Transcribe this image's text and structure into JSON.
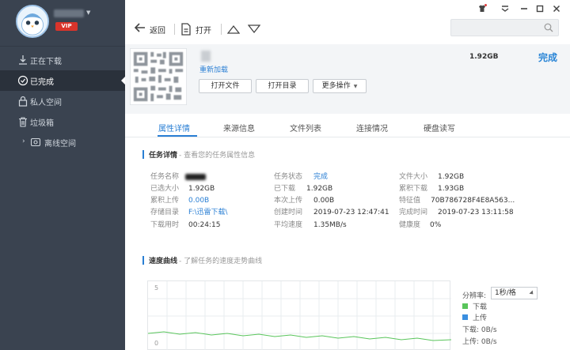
{
  "sidebar": {
    "vip_label": "VIP",
    "items": [
      {
        "label": "正在下载",
        "icon": "download-icon"
      },
      {
        "label": "已完成",
        "icon": "check-circle-icon"
      },
      {
        "label": "私人空间",
        "icon": "lock-icon"
      },
      {
        "label": "垃圾箱",
        "icon": "trash-icon"
      },
      {
        "label": "离线空间",
        "icon": "cloud-icon"
      }
    ]
  },
  "toolbar": {
    "back_label": "返回",
    "open_label": "打开"
  },
  "task": {
    "reload_label": "重新加载",
    "open_file_label": "打开文件",
    "open_dir_label": "打开目录",
    "more_label": "更多操作",
    "size": "1.92GB",
    "status": "完成"
  },
  "tabs": [
    "属性详情",
    "来源信息",
    "文件列表",
    "连接情况",
    "硬盘读写"
  ],
  "details": {
    "title": "任务详情",
    "subtitle": "- 查看您的任务属性信息",
    "rows": [
      {
        "l1": "任务名称",
        "v1": "",
        "l2": "任务状态",
        "v2": "完成",
        "l3": "文件大小",
        "v3": "1.92GB"
      },
      {
        "l1": "已选大小",
        "v1": "1.92GB",
        "l2": "已下载",
        "v2": "1.92GB",
        "l3": "累积下载",
        "v3": "1.93GB"
      },
      {
        "l1": "累积上传",
        "v1": "0.00B",
        "l2": "本次上传",
        "v2": "0.00B",
        "l3": "特征值",
        "v3": "70B786728F4E8A563..."
      },
      {
        "l1": "存储目录",
        "v1": "F:\\迅雷下载\\",
        "l2": "创建时间",
        "v2": "2019-07-23 12:47:41",
        "l3": "完成时间",
        "v3": "2019-07-23 13:11:58"
      },
      {
        "l1": "下载用时",
        "v1": "00:24:15",
        "l2": "平均速度",
        "v2": "1.35MB/s",
        "l3": "健康度",
        "v3": "0%"
      }
    ]
  },
  "speed": {
    "title": "速度曲线",
    "subtitle": "- 了解任务的速度走势曲线",
    "resolution_label": "分辨率:",
    "resolution_value": "1秒/格",
    "download_label": "下载",
    "upload_label": "上传",
    "download_speed": "下载:  0B/s",
    "upload_speed": "上传:  0B/s",
    "y_label": "5",
    "y_label_bottom": "0",
    "download_color": "#59c55b",
    "upload_color": "#3a8fe0"
  }
}
